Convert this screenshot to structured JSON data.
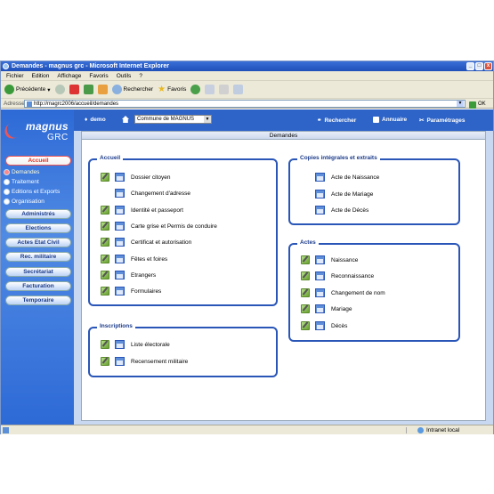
{
  "window": {
    "title": "Demandes - magnus grc - Microsoft Internet Explorer"
  },
  "menu": [
    "Fichier",
    "Edition",
    "Affichage",
    "Favoris",
    "Outils",
    "?"
  ],
  "toolbar": {
    "back": "Précédente",
    "search": "Rechercher",
    "favorites": "Favoris"
  },
  "address": {
    "label": "Adresse",
    "url": "http://magrc2006/accueil/demandes",
    "go": "OK"
  },
  "app": {
    "logo_line1": "magnus",
    "logo_line2": "GRC"
  },
  "topbar": {
    "user": "demo",
    "commune": "Commune de MAGNUS",
    "links": [
      "Rechercher",
      "Annuaire",
      "Paramétrages"
    ]
  },
  "sidebar": {
    "accueil": "Accueil",
    "items": [
      "Demandes",
      "Traitement",
      "Editions et Exports",
      "Organisation"
    ],
    "buttons": [
      "Administrés",
      "Elections",
      "Actes Etat Civil",
      "Rec. militaire",
      "Secrétariat",
      "Facturation",
      "Temporaire"
    ]
  },
  "panel": {
    "title": "Demandes"
  },
  "boxes": {
    "accueil": {
      "title": "Accueil",
      "items": [
        "Dossier citoyen",
        "Changement d'adresse",
        "Identité et passeport",
        "Carte grise et Permis de conduire",
        "Certificat et autorisation",
        "Fêtes et foires",
        "Etrangers",
        "Formulaires"
      ]
    },
    "inscriptions": {
      "title": "Inscriptions",
      "items": [
        "Liste électorale",
        "Recensement militaire"
      ]
    },
    "copies": {
      "title": "Copies intégrales et extraits",
      "items": [
        "Acte de Naissance",
        "Acte de Mariage",
        "Acte de Décès"
      ]
    },
    "actes": {
      "title": "Actes",
      "items": [
        "Naissance",
        "Reconnaissance",
        "Changement de nom",
        "Mariage",
        "Décès"
      ]
    }
  },
  "status": {
    "zone": "Intranet local"
  }
}
